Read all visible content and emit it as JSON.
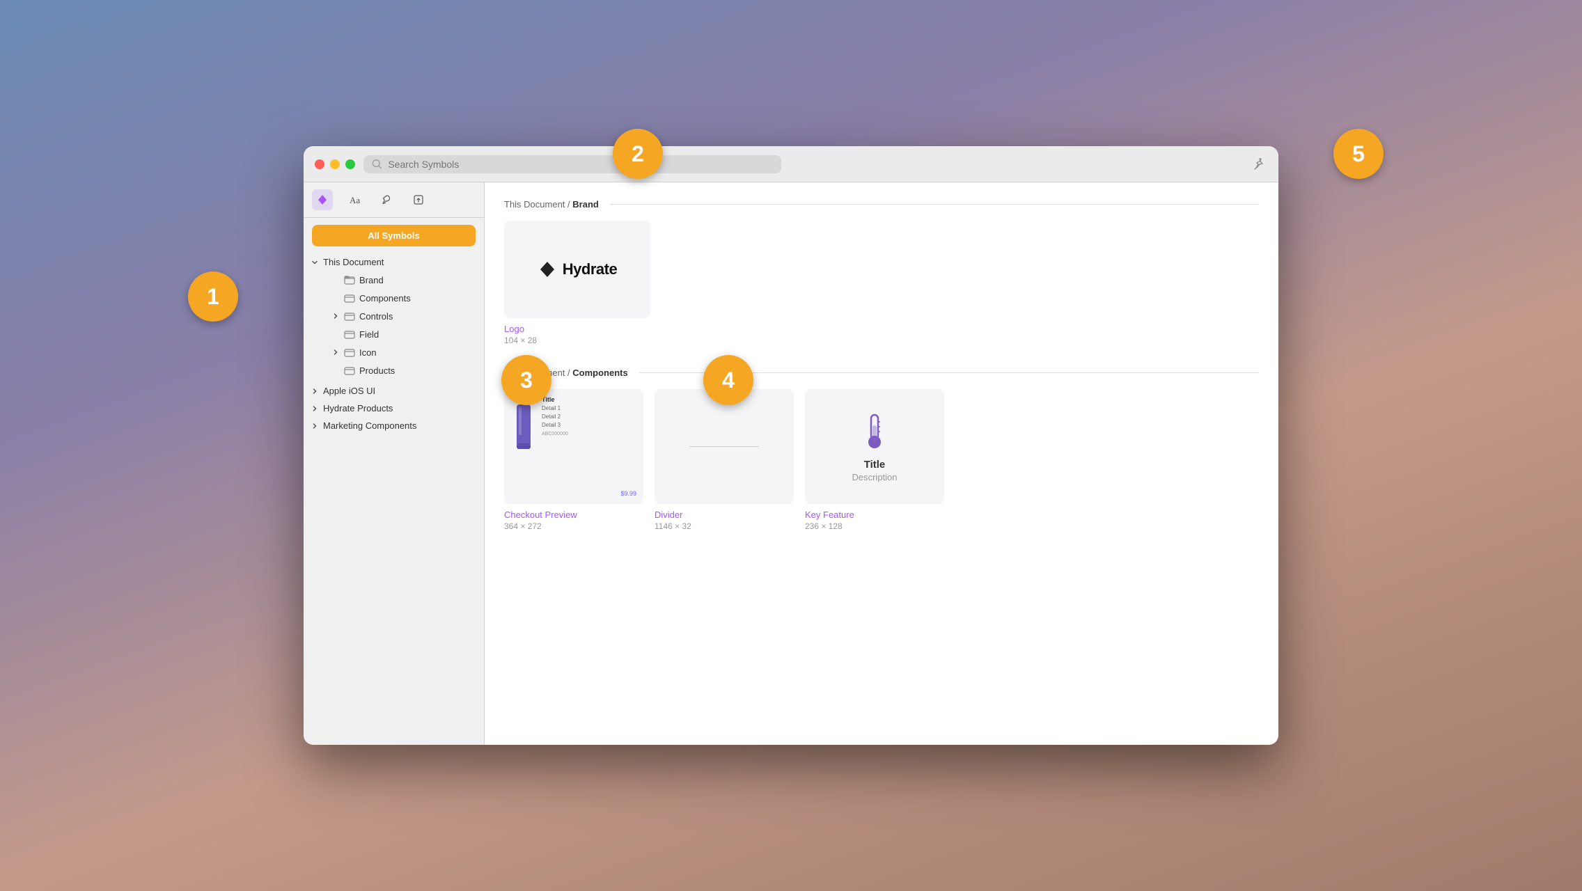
{
  "badges": [
    {
      "id": 1,
      "label": "1"
    },
    {
      "id": 2,
      "label": "2"
    },
    {
      "id": 3,
      "label": "3"
    },
    {
      "id": 4,
      "label": "4"
    },
    {
      "id": 5,
      "label": "5"
    }
  ],
  "window": {
    "titlebar": {
      "search_placeholder": "Search Symbols",
      "pin_title": "Pin"
    },
    "sidebar": {
      "toolbar_icons": [
        "diamond",
        "text",
        "paint",
        "export"
      ],
      "all_symbols_label": "All Symbols",
      "tree": {
        "this_document_label": "This Document",
        "items": [
          {
            "label": "Brand",
            "level": "child",
            "has_children": false
          },
          {
            "label": "Components",
            "level": "child",
            "has_children": false
          },
          {
            "label": "Controls",
            "level": "child",
            "has_children": true,
            "expanded": false
          },
          {
            "label": "Field",
            "level": "child",
            "has_children": false
          },
          {
            "label": "Icon",
            "level": "child",
            "has_children": true,
            "expanded": false
          },
          {
            "label": "Products",
            "level": "child",
            "has_children": false
          }
        ],
        "root_items": [
          {
            "label": "Apple iOS UI",
            "expanded": false
          },
          {
            "label": "Hydrate Products",
            "expanded": false
          },
          {
            "label": "Marketing Components",
            "expanded": false
          }
        ]
      }
    },
    "main": {
      "brand_section": {
        "breadcrumb_prefix": "This Document",
        "breadcrumb_separator": "/",
        "breadcrumb_current": "Brand",
        "symbols": [
          {
            "name": "Logo",
            "size": "104 × 28",
            "type": "logo"
          }
        ]
      },
      "components_section": {
        "breadcrumb_prefix": "This Document",
        "breadcrumb_separator": "/",
        "breadcrumb_current": "Components",
        "symbols": [
          {
            "name": "Checkout Preview",
            "size": "364 × 272",
            "type": "checkout"
          },
          {
            "name": "Divider",
            "size": "1146 × 32",
            "type": "divider"
          },
          {
            "name": "Key Feature",
            "size": "236 × 128",
            "type": "key_feature"
          }
        ]
      }
    }
  }
}
